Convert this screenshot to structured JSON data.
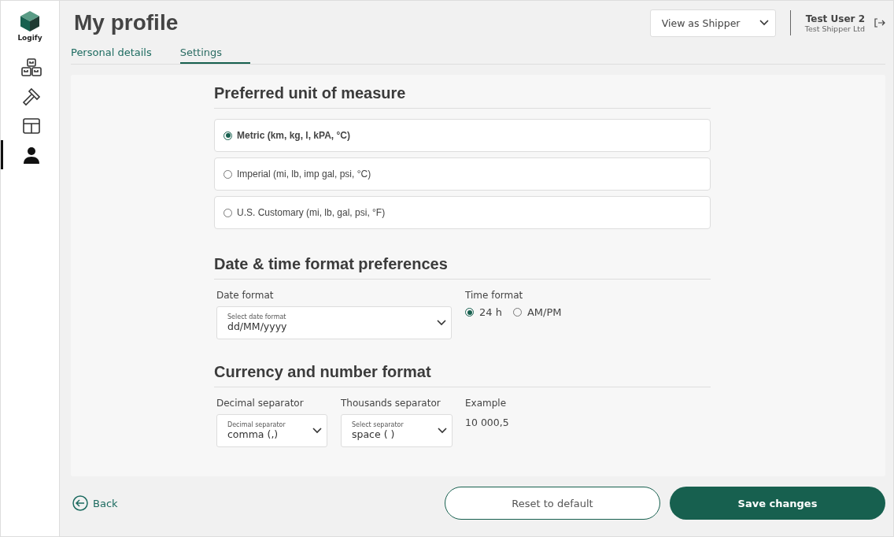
{
  "sidebar": {
    "logo_text": "Logify",
    "items": [
      {
        "kind": "boxes",
        "selected": false
      },
      {
        "kind": "hammer",
        "selected": false
      },
      {
        "kind": "layout",
        "selected": false
      },
      {
        "kind": "person",
        "selected": true
      }
    ]
  },
  "header": {
    "title": "My profile",
    "role_select": "View as Shipper",
    "user_name": "Test User 2",
    "company": "Test Shipper Ltd"
  },
  "tabs": [
    {
      "label": "Personal details",
      "selected": false
    },
    {
      "label": "Settings",
      "selected": true
    }
  ],
  "unit_section": {
    "heading": "Preferred unit of measure",
    "options": [
      {
        "label": "Metric (km, kg, l, kPA, °C)",
        "selected": true
      },
      {
        "label": "Imperial (mi, lb, imp gal, psi, °C)",
        "selected": false
      },
      {
        "label": "U.S. Customary (mi, lb, gal, psi, °F)",
        "selected": false
      }
    ]
  },
  "date_section": {
    "heading": "Date & time format preferences",
    "date_label": "Date format",
    "date_select": {
      "label": "Select date format",
      "value": "dd/MM/yyyy"
    },
    "time_label": "Time format",
    "time_options": [
      {
        "label": "24 h",
        "selected": true
      },
      {
        "label": "AM/PM",
        "selected": false
      }
    ]
  },
  "currency_section": {
    "heading": "Currency and number format",
    "decimal_label": "Decimal separator",
    "decimal_select": {
      "label": "Decimal separator",
      "value": "comma (,)"
    },
    "thousands_label": "Thousands separator",
    "thousands_select": {
      "label": "Select separator",
      "value": "space ( )"
    },
    "example_label": "Example",
    "example_value": "10 000,5"
  },
  "footer": {
    "back": "Back",
    "reset": "Reset to default",
    "save": "Save changes"
  }
}
